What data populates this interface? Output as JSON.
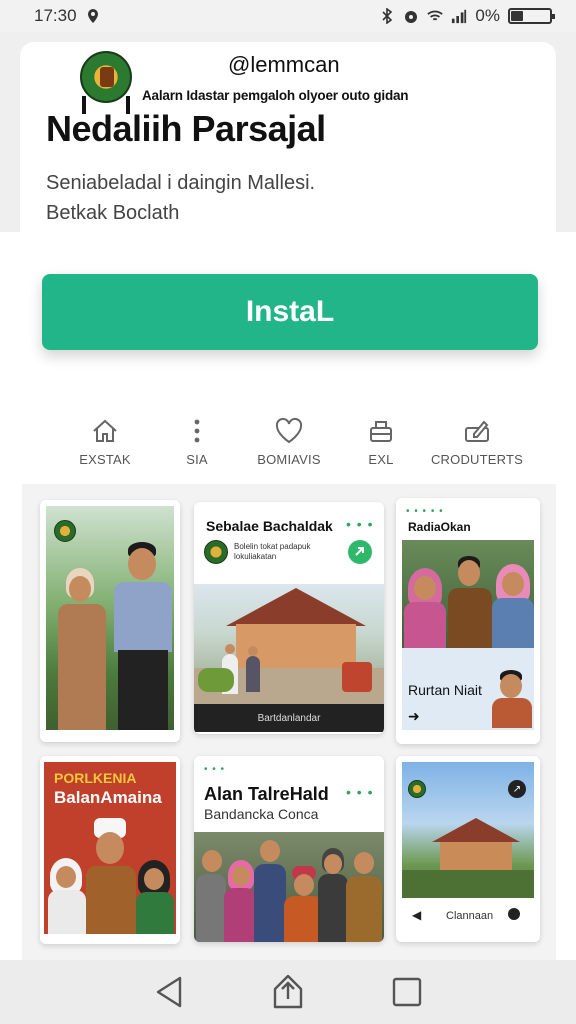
{
  "status_bar": {
    "time": "17:30",
    "battery_text": "0%",
    "icons": [
      "location-icon",
      "bluetooth-icon",
      "alarm-icon",
      "wifi-icon",
      "signal-icon",
      "battery-icon"
    ]
  },
  "app": {
    "handle": "@lemmcan",
    "tagline": "Aalarn Idastar pemgaloh olyoer outo gidan",
    "title": "Nedaliih Parsajal",
    "description_line1": "Seniabeladal i daingin Mallesi.",
    "description_line2": "Betkak Boclath"
  },
  "install_button": {
    "label": "InstaL",
    "color": "#22b58a"
  },
  "categories": [
    {
      "label": "EXSTAK",
      "icon": "home-icon"
    },
    {
      "label": "SIA",
      "icon": "more-vertical-icon"
    },
    {
      "label": "BOMIAVIS",
      "icon": "heart-icon"
    },
    {
      "label": "EXL",
      "icon": "inbox-icon"
    },
    {
      "label": "CRODUTERTS",
      "icon": "edit-icon"
    }
  ],
  "cards": {
    "card2": {
      "title": "Sebalae Bachaldak",
      "sub": "Bolelin tokat padapuk lokuliakatan",
      "caption": "Bartdanlandar"
    },
    "card3": {
      "title": "RadiaOkan",
      "sub": "Rurtan Niait"
    },
    "card4": {
      "title_line1": "PORLKENIA",
      "title_line2": "BalanAmaina"
    },
    "card5": {
      "title": "Alan TalreHald",
      "sub": "Bandancka Conca"
    },
    "card6": {
      "caption": "Clannaan"
    }
  },
  "nav_bar": {
    "icons": [
      "back-icon",
      "home-icon",
      "recents-icon"
    ]
  }
}
